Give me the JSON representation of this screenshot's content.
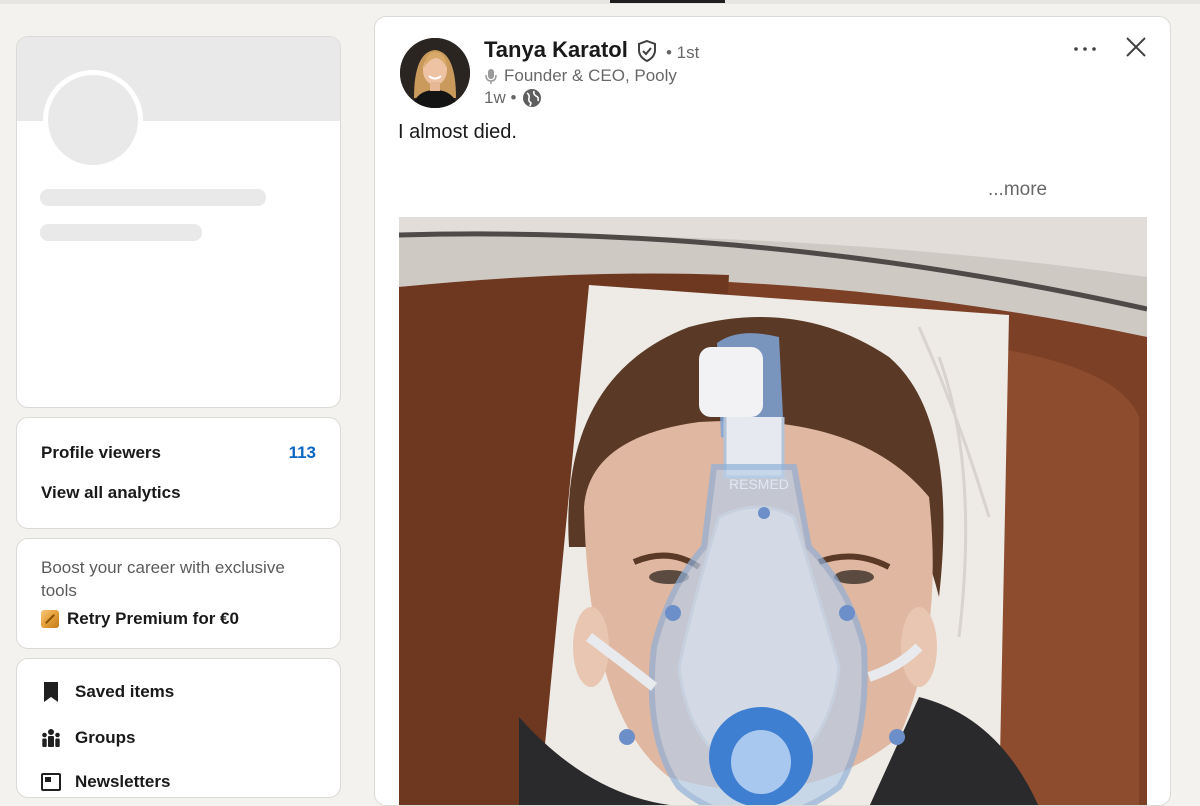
{
  "left_rail": {
    "analytics": {
      "profile_viewers_label": "Profile viewers",
      "profile_viewers_count": "113",
      "view_all_label": "View all analytics"
    },
    "premium": {
      "promo_text": "Boost your career with exclusive tools",
      "cta_label": "Retry Premium for €0",
      "icon": "premium-icon"
    },
    "shortcuts": [
      {
        "label": "Saved items",
        "icon": "bookmark-icon"
      },
      {
        "label": "Groups",
        "icon": "groups-icon"
      },
      {
        "label": "Newsletters",
        "icon": "newsletter-icon"
      }
    ]
  },
  "post": {
    "author": {
      "name": "Tanya Karatol",
      "degree": "• 1st",
      "headline": "Founder & CEO, Pooly",
      "time": "1w •",
      "verified_icon": "verified-shield-icon",
      "visibility_icon": "globe-icon"
    },
    "menu_icon": "more-options-icon",
    "close_icon": "close-icon",
    "text": "I almost died.",
    "more_label": "...more",
    "image_overlay_text": "RESMED"
  },
  "colors": {
    "accent_link": "#0a66c2",
    "page_background": "#f4f2ee",
    "card_border": "#dcdad6"
  }
}
